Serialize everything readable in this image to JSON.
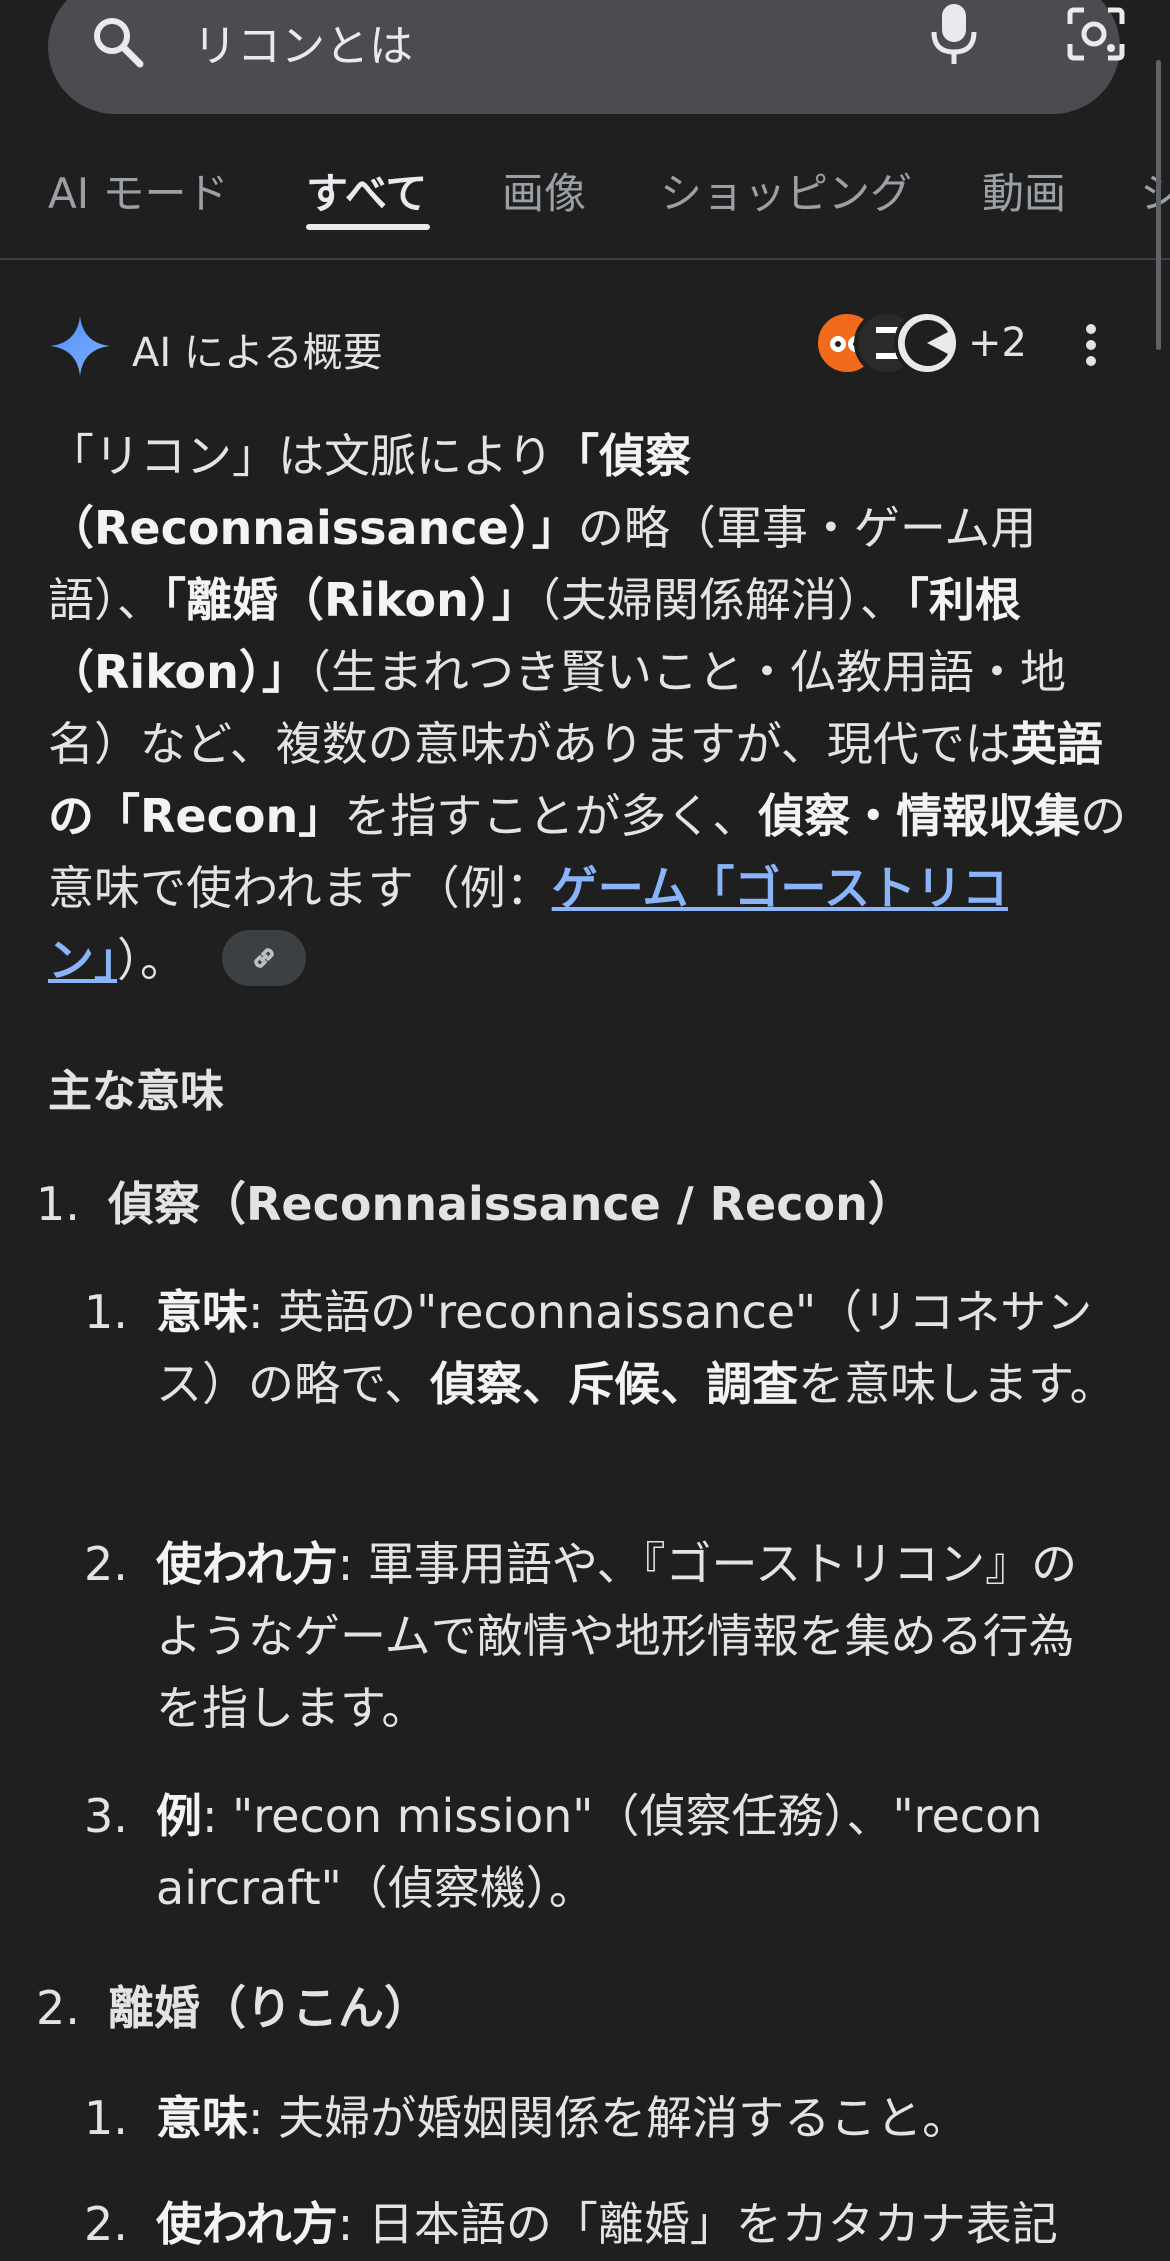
{
  "search": {
    "query": "リコンとは"
  },
  "tabs": [
    {
      "label": "AI モード"
    },
    {
      "label": "すべて"
    },
    {
      "label": "画像"
    },
    {
      "label": "ショッピング"
    },
    {
      "label": "動画"
    },
    {
      "label": "シ"
    }
  ],
  "ai_overview": {
    "title": "AI による概要",
    "sources_more": "+2",
    "intro": {
      "p1": "「リコン」は文脈により",
      "b1": "「偵察（Reconnaissance）」",
      "p2": "の略（軍事・ゲーム用語）、",
      "b2": "「離婚（Rikon）」",
      "p3": "（夫婦関係解消）、",
      "b3": "「利根（Rikon）」",
      "p4": "（生まれつき賢いこと・仏教用語・地名）など、複数の意味がありますが、現代では",
      "b4": "英語の「Recon」",
      "p5": "を指すことが多く、",
      "b5": "偵察・情報収集",
      "p6": "の意味で使われます（例：",
      "link": "ゲーム「ゴーストリコン」",
      "p7": "）。"
    },
    "main_heading": "主な意味",
    "meanings": [
      {
        "num": "1.",
        "title": "偵察（Reconnaissance / Recon）",
        "items": [
          {
            "num": "1.",
            "label": "意味",
            "text_a": ": 英語の\"reconnaissance\"（リコネサンス）の略で、",
            "bold": "偵察、斥候、調査",
            "text_b": "を意味します。"
          },
          {
            "num": "2.",
            "label": "使われ方",
            "text_a": ": 軍事用語や、『ゴーストリコン』のようなゲームで敵情や地形情報を集める行為を指します。"
          },
          {
            "num": "3.",
            "label": "例",
            "text_a": ": \"recon mission\"（偵察任務）、\"recon aircraft\"（偵察機）。"
          }
        ]
      },
      {
        "num": "2.",
        "title": "離婚（りこん）",
        "items": [
          {
            "num": "1.",
            "label": "意味",
            "text_a": ": 夫婦が婚姻関係を解消すること。"
          },
          {
            "num": "2.",
            "label": "使われ方",
            "text_a": ": 日本語の「離婚」をカタカナ表記"
          }
        ]
      }
    ]
  },
  "colors": {
    "background": "#1f1f1f",
    "link": "#8ab4f8",
    "search_bg": "#4a4c50"
  }
}
